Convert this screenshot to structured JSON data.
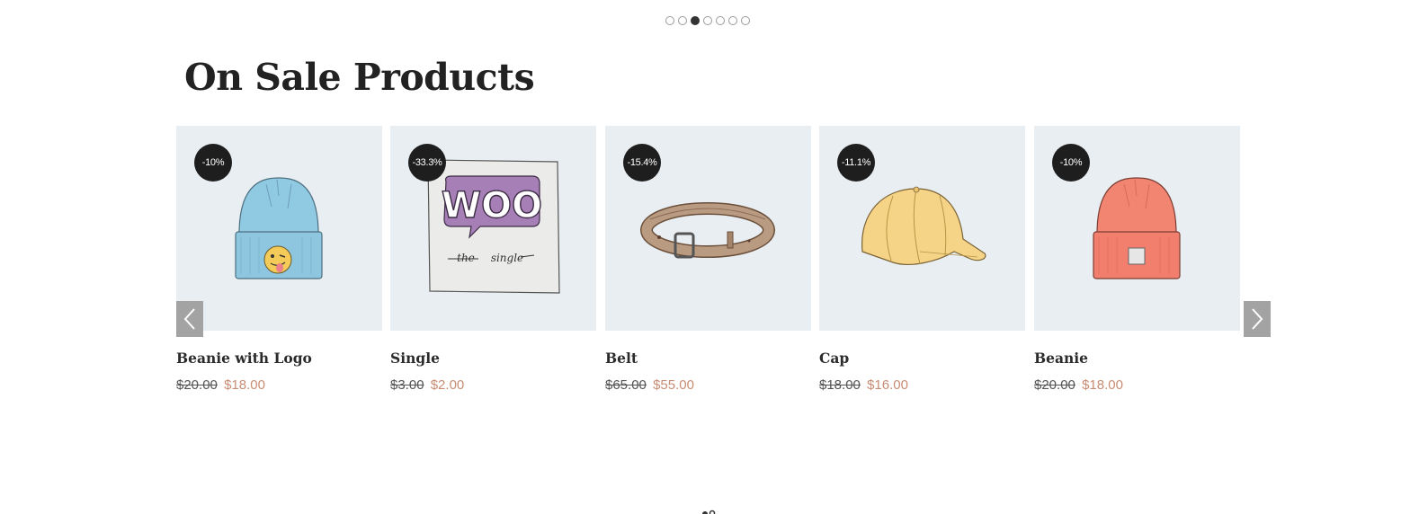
{
  "carousel_dots": {
    "count": 7,
    "active_index": 2
  },
  "section": {
    "title": "On Sale Products"
  },
  "products": [
    {
      "name": "Beanie with Logo",
      "badge": "-10%",
      "old_price": "$20.00",
      "new_price": "$18.00",
      "image_icon": "beanie-logo-icon"
    },
    {
      "name": "Single",
      "badge": "-33.3%",
      "old_price": "$3.00",
      "new_price": "$2.00",
      "image_icon": "woo-single-icon"
    },
    {
      "name": "Belt",
      "badge": "-15.4%",
      "old_price": "$65.00",
      "new_price": "$55.00",
      "image_icon": "belt-icon"
    },
    {
      "name": "Cap",
      "badge": "-11.1%",
      "old_price": "$18.00",
      "new_price": "$16.00",
      "image_icon": "cap-icon"
    },
    {
      "name": "Beanie",
      "badge": "-10%",
      "old_price": "$20.00",
      "new_price": "$18.00",
      "image_icon": "beanie-icon"
    }
  ],
  "nav": {
    "prev_icon": "chevron-left-icon",
    "next_icon": "chevron-right-icon"
  },
  "colors": {
    "card_bg": "#e9eef2",
    "badge_bg": "#1e1e1e",
    "sale_price": "#c98c74",
    "arrow_bg": "#a3a3a3"
  }
}
